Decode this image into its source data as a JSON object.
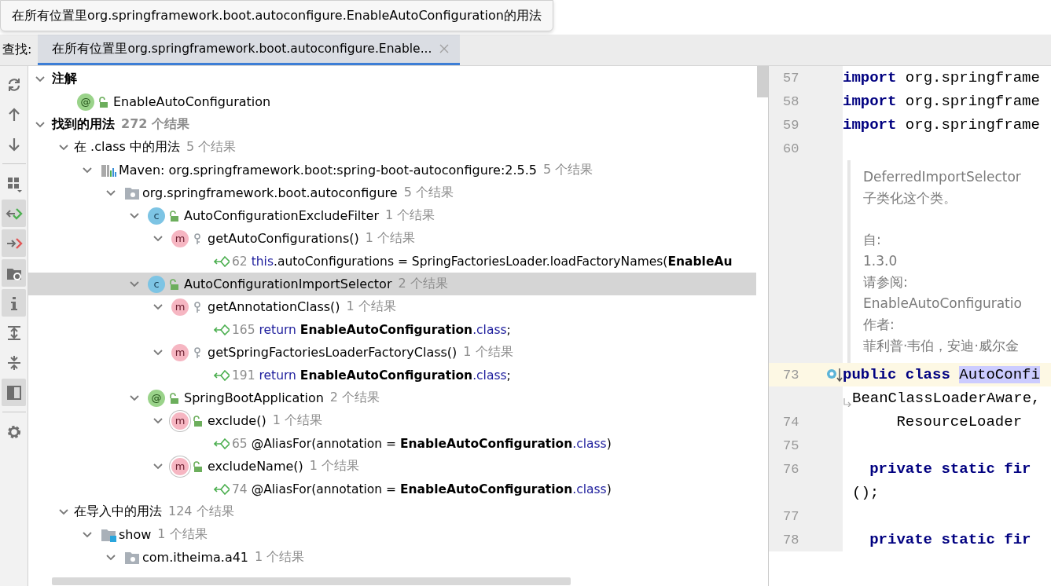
{
  "tooltip": {
    "text": "在所有位置里org.springframework.boot.autoconfigure.EnableAutoConfiguration的用法"
  },
  "find_bar": {
    "label": "查找:",
    "tabs": [
      {
        "label": "在所有位置里org.springframework.boot.autoconfigure.Enable...",
        "selected": true
      }
    ]
  },
  "toolbar": [
    {
      "kind": "refresh",
      "on": false
    },
    {
      "kind": "up",
      "on": false
    },
    {
      "kind": "down",
      "on": false
    },
    {
      "kind": "group",
      "on": false
    },
    {
      "kind": "read",
      "on": true
    },
    {
      "kind": "write",
      "on": true
    },
    {
      "kind": "folder",
      "on": true
    },
    {
      "kind": "info",
      "on": true
    },
    {
      "kind": "expand",
      "on": false
    },
    {
      "kind": "collapse",
      "on": false
    },
    {
      "kind": "preview",
      "on": true
    },
    {
      "kind": "settings",
      "on": false
    }
  ],
  "tree": [
    {
      "kind": "group",
      "label": "注解",
      "expanded": true,
      "selected": false,
      "children": [
        {
          "kind": "annotation",
          "badge": "@",
          "public": true,
          "label": "EnableAutoConfiguration",
          "selected": false
        }
      ]
    },
    {
      "kind": "group",
      "label": "找到的用法",
      "count": "272 个结果",
      "expanded": true,
      "selected": false,
      "children": [
        {
          "kind": "category",
          "label": "在 .class 中的用法",
          "count": "5 个结果",
          "expanded": true,
          "selected": false,
          "children": [
            {
              "kind": "maven",
              "label": "Maven: org.springframework.boot:spring-boot-autoconfigure:2.5.5",
              "count": "5 个结果",
              "expanded": true,
              "selected": false,
              "children": [
                {
                  "kind": "package",
                  "label": "org.springframework.boot.autoconfigure",
                  "count": "5 个结果",
                  "expanded": true,
                  "selected": false,
                  "children": [
                    {
                      "kind": "class",
                      "badge": "c",
                      "public": true,
                      "label": "AutoConfigurationExcludeFilter",
                      "count": "1 个结果",
                      "expanded": true,
                      "selected": false,
                      "children": [
                        {
                          "kind": "method",
                          "badge": "m",
                          "public": false,
                          "label": "getAutoConfigurations()",
                          "count": "1 个结果",
                          "expanded": true,
                          "selected": false,
                          "children": [
                            {
                              "kind": "usage",
                              "line": "62",
                              "selected": false,
                              "parts": [
                                {
                                  "kind": "keyword",
                                  "text": "this"
                                },
                                {
                                  "kind": "plain",
                                  "text": ".autoConfigurations = SpringFactoriesLoader.loadFactoryNames("
                                },
                                {
                                  "kind": "match",
                                  "text": "EnableAu"
                                }
                              ]
                            }
                          ]
                        }
                      ]
                    },
                    {
                      "kind": "class",
                      "badge": "c",
                      "public": true,
                      "label": "AutoConfigurationImportSelector",
                      "count": "2 个结果",
                      "expanded": true,
                      "selected": true,
                      "children": [
                        {
                          "kind": "method",
                          "badge": "m",
                          "public": false,
                          "label": "getAnnotationClass()",
                          "count": "1 个结果",
                          "expanded": true,
                          "selected": false,
                          "children": [
                            {
                              "kind": "usage",
                              "line": "165",
                              "selected": false,
                              "parts": [
                                {
                                  "kind": "keyword",
                                  "text": "return "
                                },
                                {
                                  "kind": "match",
                                  "text": "EnableAutoConfiguration"
                                },
                                {
                                  "kind": "keyword",
                                  "text": ".class"
                                },
                                {
                                  "kind": "plain",
                                  "text": ";"
                                }
                              ]
                            }
                          ]
                        },
                        {
                          "kind": "method",
                          "badge": "m",
                          "public": false,
                          "label": "getSpringFactoriesLoaderFactoryClass()",
                          "count": "1 个结果",
                          "expanded": true,
                          "selected": false,
                          "children": [
                            {
                              "kind": "usage",
                              "line": "191",
                              "selected": false,
                              "parts": [
                                {
                                  "kind": "keyword",
                                  "text": "return "
                                },
                                {
                                  "kind": "match",
                                  "text": "EnableAutoConfiguration"
                                },
                                {
                                  "kind": "keyword",
                                  "text": ".class"
                                },
                                {
                                  "kind": "plain",
                                  "text": ";"
                                }
                              ]
                            }
                          ]
                        }
                      ]
                    },
                    {
                      "kind": "annotation",
                      "badge": "@",
                      "public": true,
                      "label": "SpringBootApplication",
                      "count": "2 个结果",
                      "expanded": true,
                      "selected": false,
                      "children": [
                        {
                          "kind": "annotation-method",
                          "badge": "m",
                          "public": true,
                          "label": "exclude()",
                          "count": "1 个结果",
                          "expanded": true,
                          "selected": false,
                          "children": [
                            {
                              "kind": "usage",
                              "line": "65",
                              "selected": false,
                              "parts": [
                                {
                                  "kind": "plain",
                                  "text": "@AliasFor(annotation = "
                                },
                                {
                                  "kind": "match",
                                  "text": "EnableAutoConfiguration"
                                },
                                {
                                  "kind": "keyword",
                                  "text": ".class"
                                },
                                {
                                  "kind": "plain",
                                  "text": ")"
                                }
                              ]
                            }
                          ]
                        },
                        {
                          "kind": "annotation-method",
                          "badge": "m",
                          "public": true,
                          "label": "excludeName()",
                          "count": "1 个结果",
                          "expanded": true,
                          "selected": false,
                          "children": [
                            {
                              "kind": "usage",
                              "line": "74",
                              "selected": false,
                              "parts": [
                                {
                                  "kind": "plain",
                                  "text": "@AliasFor(annotation = "
                                },
                                {
                                  "kind": "match",
                                  "text": "EnableAutoConfiguration"
                                },
                                {
                                  "kind": "keyword",
                                  "text": ".class"
                                },
                                {
                                  "kind": "plain",
                                  "text": ")"
                                }
                              ]
                            }
                          ]
                        }
                      ]
                    }
                  ]
                }
              ]
            }
          ]
        },
        {
          "kind": "category",
          "label": "在导入中的用法",
          "count": "124 个结果",
          "expanded": true,
          "selected": false,
          "children": [
            {
              "kind": "module",
              "label": "show",
              "count": "1 个结果",
              "expanded": true,
              "selected": false,
              "children": [
                {
                  "kind": "package",
                  "label": "com.itheima.a41",
                  "count": "1 个结果",
                  "expanded": true,
                  "selected": false
                }
              ]
            }
          ]
        }
      ]
    }
  ],
  "editor": {
    "lines": [
      {
        "kind": "code",
        "number": "57",
        "tokens": [
          {
            "kind": "keyword",
            "text": "import"
          },
          {
            "kind": "plain",
            "text": " org.springframe"
          }
        ]
      },
      {
        "kind": "code",
        "number": "58",
        "tokens": [
          {
            "kind": "keyword",
            "text": "import"
          },
          {
            "kind": "plain",
            "text": " org.springframe"
          }
        ]
      },
      {
        "kind": "code",
        "number": "59",
        "tokens": [
          {
            "kind": "keyword",
            "text": "import"
          },
          {
            "kind": "plain",
            "text": " org.springframe"
          }
        ]
      },
      {
        "kind": "code",
        "number": "60"
      },
      {
        "kind": "doc",
        "sections": [
          {
            "paragraphs": [
              "DeferredImportSelector",
              "子类化这个类。"
            ]
          },
          {
            "paragraphs": [
              "自:",
              "1.3.0",
              "请参阅:",
              "EnableAutoConfiguratio",
              "作者:",
              "菲利普·韦伯，安迪·威尔金"
            ]
          }
        ]
      },
      {
        "kind": "code",
        "number": "73",
        "current": true,
        "marker": true,
        "tokens": [
          {
            "kind": "keyword",
            "text": "public class "
          },
          {
            "kind": "selection",
            "text": "AutoConfi"
          }
        ]
      },
      {
        "kind": "wrap",
        "tokens": [
          {
            "kind": "plain",
            "text": "BeanClassLoaderAware,"
          }
        ]
      },
      {
        "kind": "code",
        "number": "74",
        "tokens": [
          {
            "kind": "plain",
            "text": "      ResourceLoader"
          }
        ]
      },
      {
        "kind": "code",
        "number": "75"
      },
      {
        "kind": "code",
        "number": "76",
        "tokens": [
          {
            "kind": "keyword",
            "text": "   private static fir"
          }
        ]
      },
      {
        "kind": "continuation",
        "tokens": [
          {
            "kind": "plain",
            "text": "();"
          }
        ]
      },
      {
        "kind": "code",
        "number": "77"
      },
      {
        "kind": "code",
        "number": "78",
        "tokens": [
          {
            "kind": "keyword",
            "text": "   private static fir"
          }
        ]
      }
    ]
  }
}
